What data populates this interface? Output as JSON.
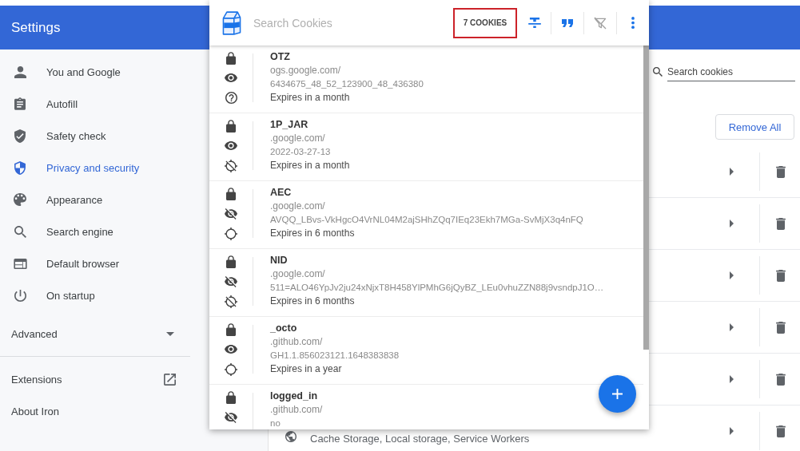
{
  "settings_header": {
    "title": "Settings"
  },
  "sidebar": {
    "items": [
      {
        "label": "You and Google",
        "selected": false
      },
      {
        "label": "Autofill",
        "selected": false
      },
      {
        "label": "Safety check",
        "selected": false
      },
      {
        "label": "Privacy and security",
        "selected": true
      },
      {
        "label": "Appearance",
        "selected": false
      },
      {
        "label": "Search engine",
        "selected": false
      },
      {
        "label": "Default browser",
        "selected": false
      },
      {
        "label": "On startup",
        "selected": false
      }
    ],
    "advanced": {
      "label": "Advanced",
      "expanded": false
    },
    "links": [
      {
        "label": "Extensions",
        "external": true
      },
      {
        "label": "About Iron",
        "external": false
      }
    ]
  },
  "main": {
    "search": {
      "placeholder": "Search cookies"
    },
    "remove_all_button": "Remove All",
    "site_rows": [
      {
        "kind": "covered"
      },
      {
        "kind": "covered"
      },
      {
        "kind": "covered"
      },
      {
        "kind": "covered"
      },
      {
        "kind": "covered"
      },
      {
        "kind": "site",
        "details": "Cache Storage, Local storage, Service Workers"
      }
    ]
  },
  "popup": {
    "search": {
      "placeholder": "Search Cookies"
    },
    "cookie_count": {
      "text": "7 COOKIES",
      "highlighted": true
    },
    "toolbar": [
      {
        "disabled": false
      },
      {
        "disabled": false
      },
      {
        "disabled": true
      },
      {
        "disabled": false
      }
    ],
    "cookies": [
      {
        "name": "OTZ",
        "domain": "ogs.google.com/",
        "value": "6434675_48_52_123900_48_436380",
        "expires": "Expires in a month",
        "secure": true,
        "http_only": false,
        "same_site": {
          "kind": "unspecified"
        }
      },
      {
        "name": "1P_JAR",
        "domain": ".google.com/",
        "value": "2022-03-27-13",
        "expires": "Expires in a month",
        "secure": true,
        "http_only": false,
        "same_site": {
          "kind": "none"
        }
      },
      {
        "name": "AEC",
        "domain": ".google.com/",
        "value": "AVQQ_LBvs-VkHgcO4VrNL04M2ajSHhZQq7IEq23Ekh7MGa-SvMjX3q4nFQ",
        "expires": "Expires in 6 months",
        "secure": true,
        "http_only": true,
        "same_site": {
          "kind": "lax"
        }
      },
      {
        "name": "NID",
        "domain": ".google.com/",
        "value": "511=ALO46YpJv2ju24xNjxT8H458YlPMhG6jQyBZ_LEu0vhuZZN88j9vsndpJ1O…",
        "expires": "Expires in 6 months",
        "secure": true,
        "http_only": true,
        "same_site": {
          "kind": "none"
        }
      },
      {
        "name": "_octo",
        "domain": ".github.com/",
        "value": "GH1.1.856023121.1648383838",
        "expires": "Expires in a year",
        "secure": true,
        "http_only": false,
        "same_site": {
          "kind": "lax"
        }
      },
      {
        "name": "logged_in",
        "domain": ".github.com/",
        "value": "no",
        "secure": true,
        "http_only": true
      }
    ]
  }
}
